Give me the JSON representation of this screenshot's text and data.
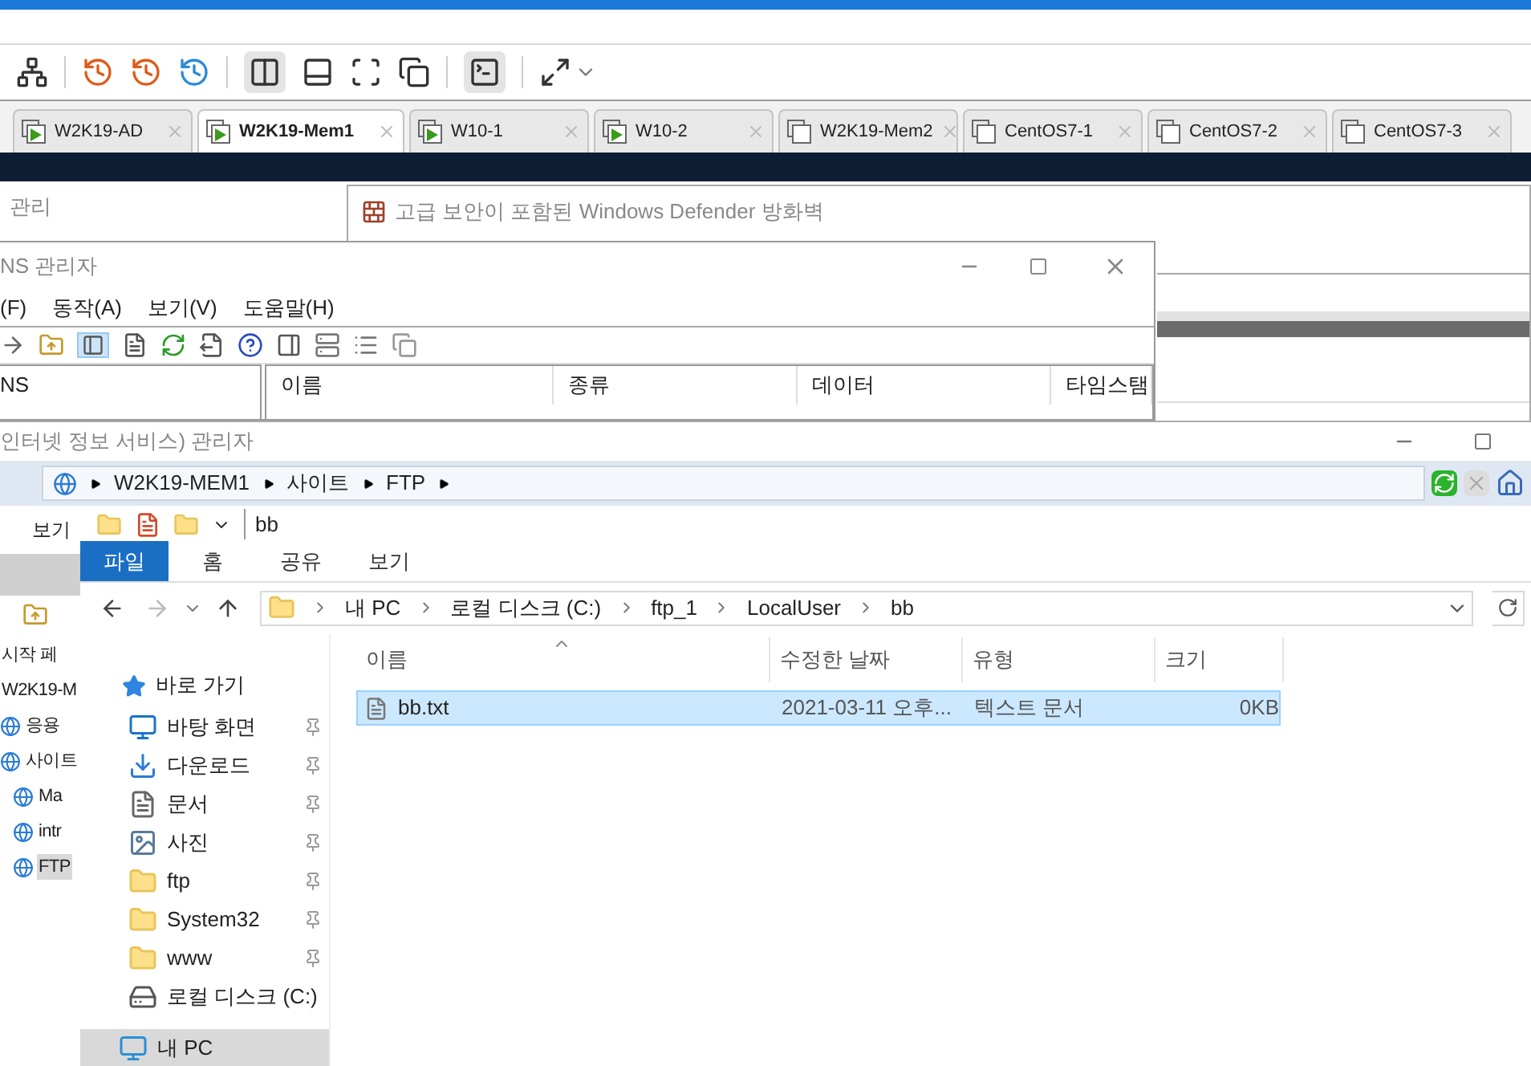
{
  "vm_tabs": [
    {
      "label": "W2K19-AD",
      "selected": false,
      "running": true
    },
    {
      "label": "W2K19-Mem1",
      "selected": true,
      "running": true
    },
    {
      "label": "W10-1",
      "selected": false,
      "running": true
    },
    {
      "label": "W10-2",
      "selected": false,
      "running": true
    },
    {
      "label": "W2K19-Mem2",
      "selected": false,
      "running": false
    },
    {
      "label": "CentOS7-1",
      "selected": false,
      "running": false
    },
    {
      "label": "CentOS7-2",
      "selected": false,
      "running": false
    },
    {
      "label": "CentOS7-3",
      "selected": false,
      "running": false
    }
  ],
  "server_manager": {
    "title": "관리"
  },
  "firewall": {
    "title": "고급 보안이 포함된 Windows Defender 방화벽"
  },
  "dns_manager": {
    "title": "NS 관리자",
    "menu": [
      "(F)",
      "동작(A)",
      "보기(V)",
      "도움말(H)"
    ],
    "tree_root": "NS",
    "columns": [
      "이름",
      "종류",
      "데이터",
      "타임스탬"
    ]
  },
  "iis_manager": {
    "title": "인터넷 정보 서비스) 관리자",
    "address": [
      "W2K19-MEM1",
      "사이트",
      "FTP"
    ],
    "menu": [
      "보기"
    ],
    "tree": [
      {
        "label": "시작 페",
        "selected": false
      },
      {
        "label": "W2K19-M",
        "selected": false,
        "children": [
          {
            "label": "응용",
            "selected": false
          },
          {
            "label": "사이트",
            "selected": false,
            "children": [
              {
                "label": "Ma",
                "selected": false
              },
              {
                "label": "intr",
                "selected": false
              },
              {
                "label": "FTP",
                "selected": true
              }
            ]
          }
        ]
      }
    ]
  },
  "explorer": {
    "title": "bb",
    "ribbon_tabs": [
      {
        "label": "파일",
        "selected": true
      },
      {
        "label": "홈",
        "selected": false
      },
      {
        "label": "공유",
        "selected": false
      },
      {
        "label": "보기",
        "selected": false
      }
    ],
    "path": [
      "내 PC",
      "로컬 디스크 (C:)",
      "ftp_1",
      "LocalUser",
      "bb"
    ],
    "nav": [
      {
        "label": "바로 가기",
        "kind": "quick",
        "pinned": false,
        "selected": false
      },
      {
        "label": "바탕 화면",
        "kind": "desktop",
        "pinned": true,
        "selected": false
      },
      {
        "label": "다운로드",
        "kind": "download",
        "pinned": true,
        "selected": false
      },
      {
        "label": "문서",
        "kind": "document",
        "pinned": true,
        "selected": false
      },
      {
        "label": "사진",
        "kind": "pictures",
        "pinned": true,
        "selected": false
      },
      {
        "label": "ftp",
        "kind": "folder",
        "pinned": true,
        "selected": false
      },
      {
        "label": "System32",
        "kind": "folder",
        "pinned": true,
        "selected": false
      },
      {
        "label": "www",
        "kind": "folder",
        "pinned": true,
        "selected": false
      },
      {
        "label": "로컬 디스크 (C:)",
        "kind": "drive",
        "pinned": false,
        "selected": false
      },
      {
        "label": "내 PC",
        "kind": "pc",
        "pinned": false,
        "selected": true
      }
    ],
    "columns": [
      "이름",
      "수정한 날짜",
      "유형",
      "크기"
    ],
    "files": [
      {
        "name": "bb.txt",
        "modified": "2021-03-11 오후...",
        "type": "텍스트 문서",
        "size": "0KB",
        "selected": true
      }
    ]
  }
}
